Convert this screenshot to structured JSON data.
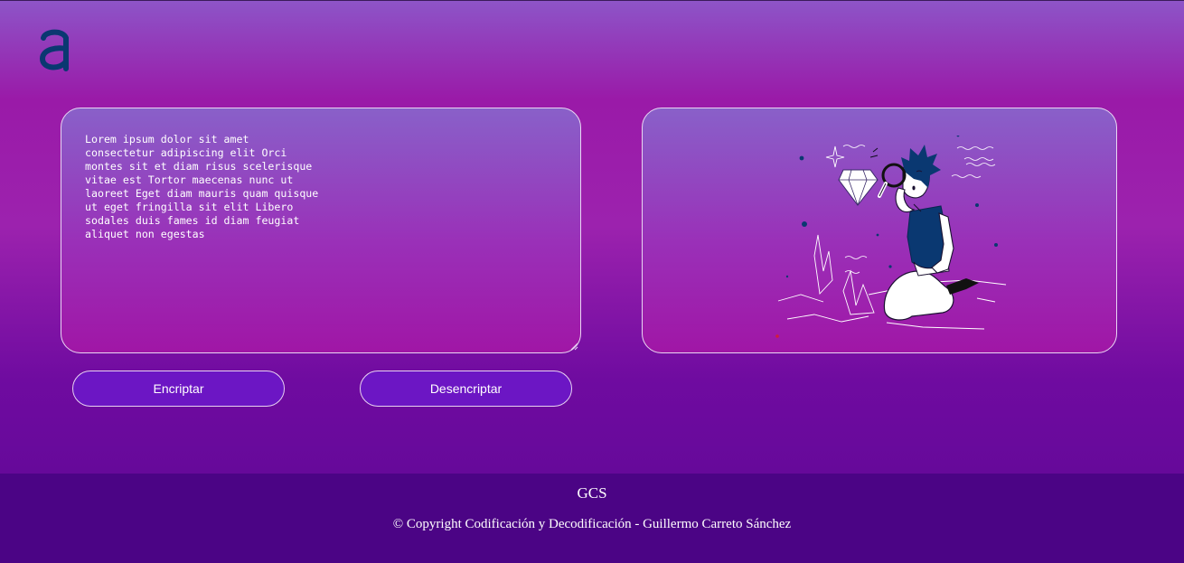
{
  "logo": {
    "icon": "alura-a-logo-icon",
    "color": "#0a3871"
  },
  "input": {
    "text": "Lorem ipsum dolor sit amet consectetur adipiscing elit Orci montes sit et diam risus scelerisque vitae est Tortor maecenas nunc ut laoreet Eget diam mauris quam quisque ut eget fringilla sit elit Libero sodales duis fames id diam feugiat aliquet non egestas"
  },
  "output_panel": {
    "illustration": "person-searching-diamond-illustration"
  },
  "actions": {
    "encrypt_label": "Encriptar",
    "decrypt_label": "Desencriptar"
  },
  "footer": {
    "title": "GCS",
    "copyright": "© Copyright Codificación y Decodificación - Guillermo Carreto Sánchez"
  },
  "colors": {
    "button_bg": "#6c16c4",
    "footer_bg": "#4b0485",
    "logo": "#0a3871"
  }
}
